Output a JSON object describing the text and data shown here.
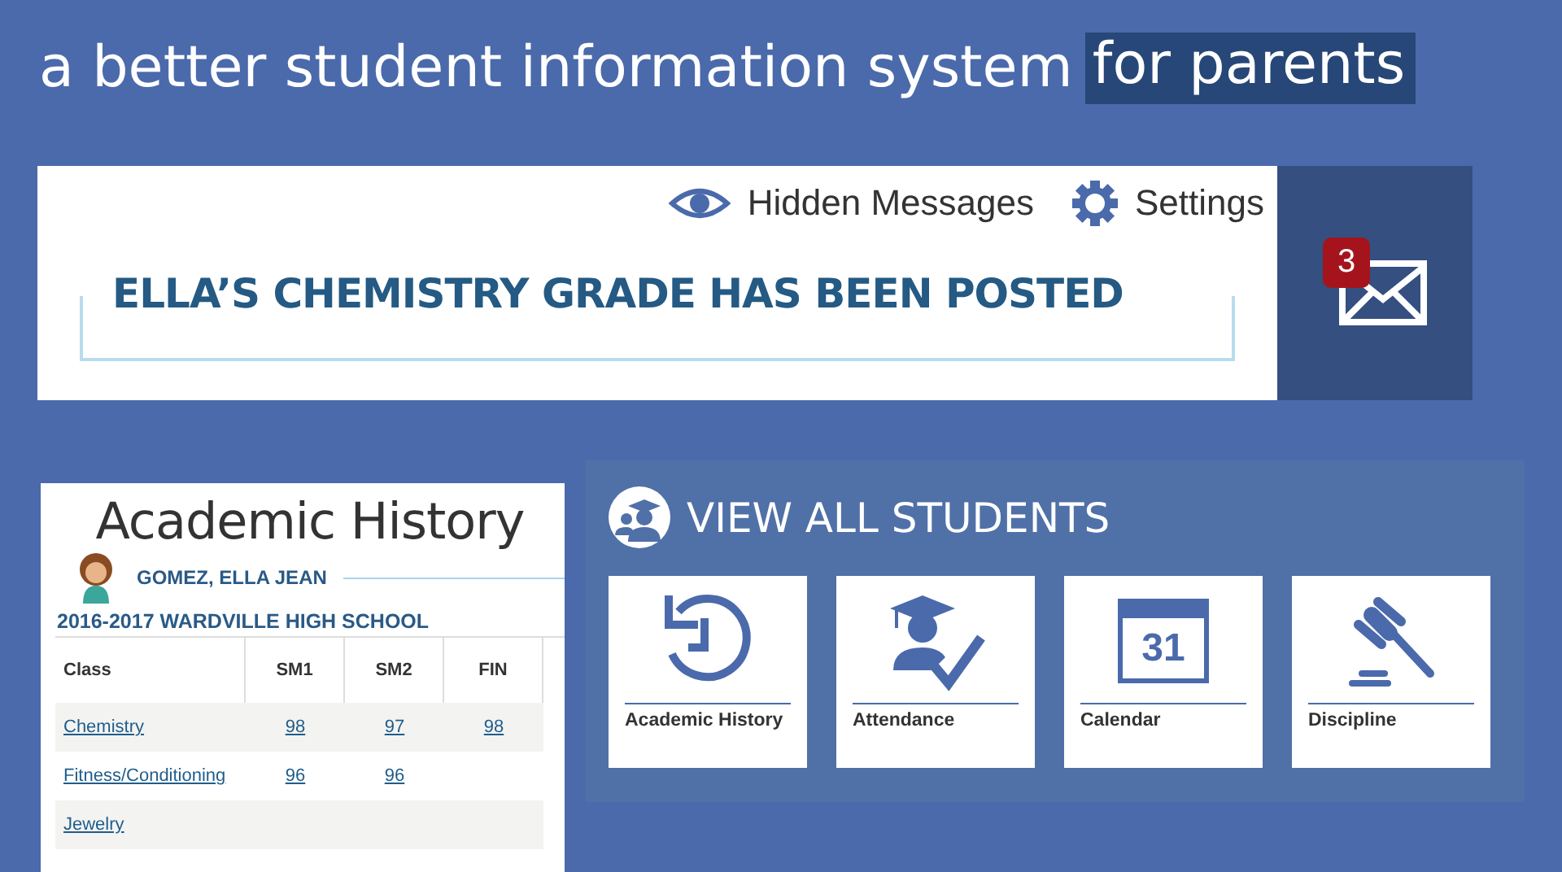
{
  "headline": {
    "text": "a better student information system",
    "highlight": "for parents"
  },
  "notification": {
    "links": [
      {
        "kind": "eye",
        "label": "Hidden Messages"
      },
      {
        "kind": "gear",
        "label": "Settings"
      }
    ],
    "message": "ELLA’S CHEMISTRY GRADE HAS BEEN POSTED",
    "unread_count": "3"
  },
  "academic_history": {
    "title": "Academic History",
    "student": "GOMEZ, ELLA JEAN",
    "school_year": "2016-2017 WARDVILLE HIGH SCHOOL",
    "columns": [
      "Class",
      "SM1",
      "SM2",
      "FIN"
    ],
    "rows": [
      {
        "class": "Chemistry",
        "grades": [
          "98",
          "97",
          "98"
        ]
      },
      {
        "class": "Fitness/Conditioning",
        "grades": [
          "96",
          "96"
        ]
      },
      {
        "class": "Jewelry",
        "grades": []
      }
    ]
  },
  "students_panel": {
    "title": "VIEW ALL STUDENTS",
    "tiles": [
      {
        "kind": "history",
        "label": "Academic History"
      },
      {
        "kind": "attendance",
        "label": "Attendance"
      },
      {
        "kind": "calendar",
        "label": "Calendar",
        "day": "31"
      },
      {
        "kind": "discipline",
        "label": "Discipline"
      }
    ]
  }
}
